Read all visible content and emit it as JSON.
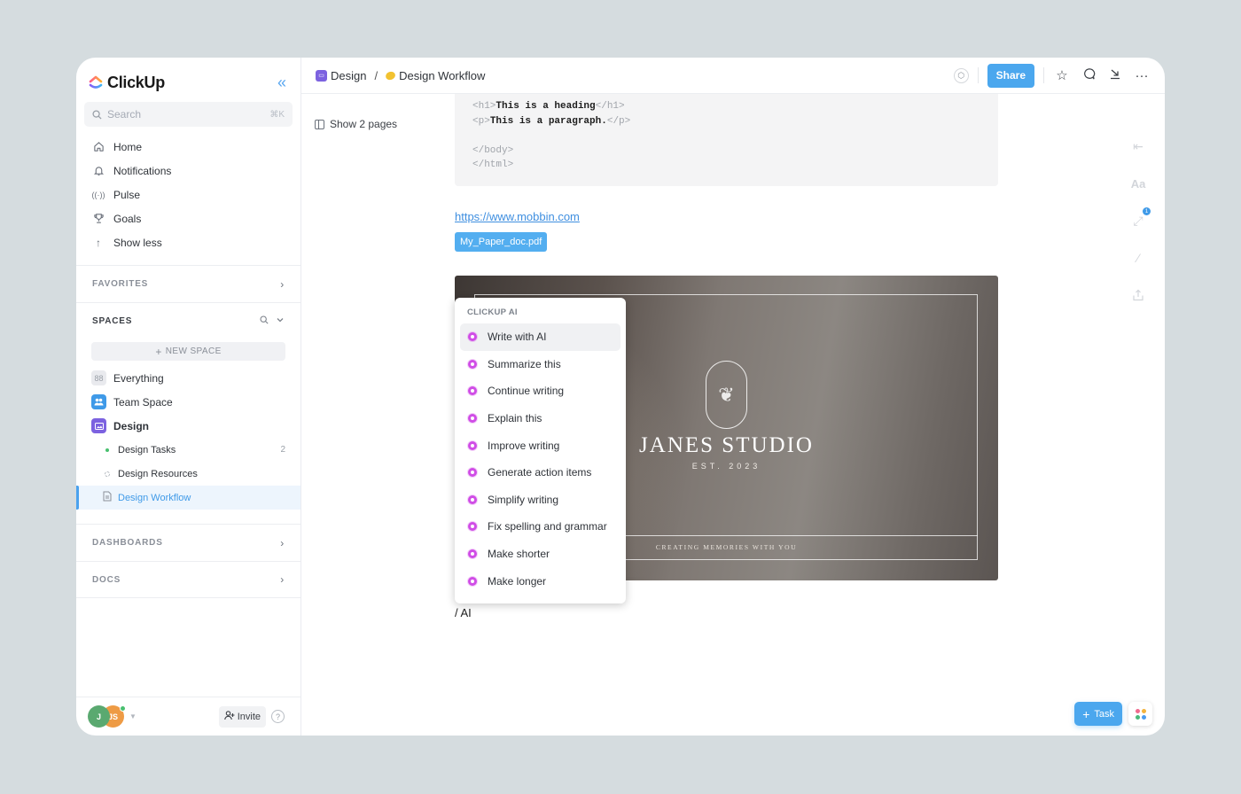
{
  "app": {
    "name": "ClickUp"
  },
  "sidebar": {
    "search": {
      "placeholder": "Search",
      "shortcut": "⌘K"
    },
    "nav": [
      {
        "label": "Home",
        "icon": "home-icon"
      },
      {
        "label": "Notifications",
        "icon": "bell-icon"
      },
      {
        "label": "Pulse",
        "icon": "pulse-icon"
      },
      {
        "label": "Goals",
        "icon": "trophy-icon"
      },
      {
        "label": "Show less",
        "icon": "arrow-up-icon"
      }
    ],
    "favorites_label": "FAVORITES",
    "spaces_label": "SPACES",
    "new_space_label": "NEW SPACE",
    "spaces": [
      {
        "label": "Everything",
        "color": "#e9eaee"
      },
      {
        "label": "Team Space",
        "color": "#3f9ae8"
      },
      {
        "label": "Design",
        "color": "#7c62e0"
      }
    ],
    "design_children": [
      {
        "label": "Design Tasks",
        "count": "2",
        "icon": "green-dot"
      },
      {
        "label": "Design Resources",
        "count": "",
        "icon": "dotted-circle"
      },
      {
        "label": "Design Workflow",
        "count": "",
        "icon": "doc-icon",
        "active": true
      }
    ],
    "dashboards_label": "DASHBOARDS",
    "docs_label": "DOCS",
    "footer": {
      "avatars": [
        "J",
        "JS"
      ],
      "invite_label": "Invite",
      "help_label": "?"
    }
  },
  "topbar": {
    "breadcrumb": [
      "Design",
      "Design Workflow"
    ],
    "separator": "/",
    "share_label": "Share"
  },
  "doc": {
    "show_pages_label": "Show 2 pages",
    "code_lines": [
      {
        "open": "<h1>",
        "text": "This is a heading",
        "close": "</h1>"
      },
      {
        "open": "<p>",
        "text": "This is a paragraph.",
        "close": "</p>"
      },
      {
        "open": "",
        "text": "",
        "close": ""
      },
      {
        "open": "</body>",
        "text": "",
        "close": ""
      },
      {
        "open": "</html>",
        "text": "",
        "close": ""
      }
    ],
    "link": "https://www.mobbin.com",
    "file_chip": "My_Paper_doc.pdf",
    "image": {
      "title": "JANES STUDIO",
      "est": "EST. 2023",
      "tagline": "CREATING MEMORIES WITH YOU"
    },
    "slash_command": "/ AI"
  },
  "ai_menu": {
    "title": "CLICKUP AI",
    "items": [
      "Write with AI",
      "Summarize this",
      "Continue writing",
      "Explain this",
      "Improve writing",
      "Generate action items",
      "Simplify writing",
      "Fix spelling and grammar",
      "Make shorter",
      "Make longer"
    ],
    "highlighted_index": 0
  },
  "right_rail": {
    "text_size_label": "Aa",
    "badge_count": "1"
  },
  "fab": {
    "task_label": "Task"
  },
  "colors": {
    "accent": "#4ba7ee",
    "ai": "#d04de6",
    "design_space": "#7c62e0"
  }
}
